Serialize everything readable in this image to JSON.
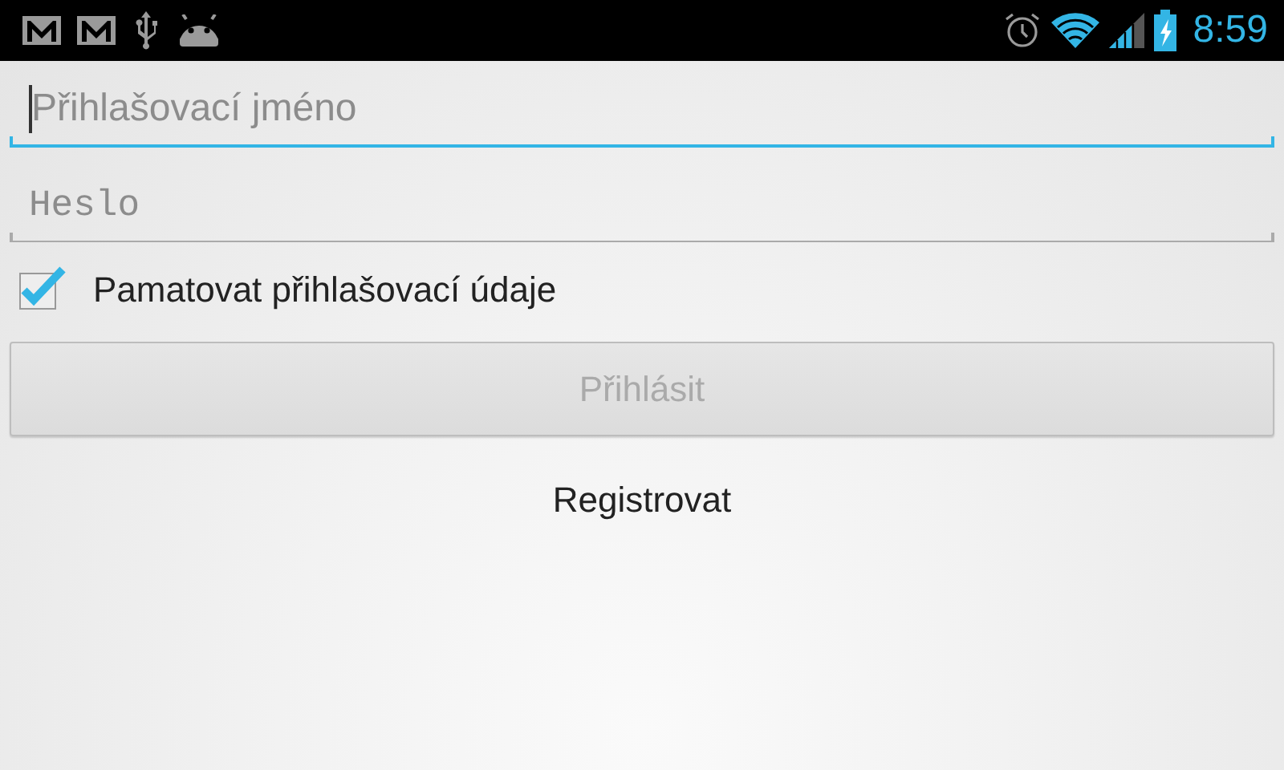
{
  "status_bar": {
    "time": "8:59"
  },
  "fields": [
    {
      "placeholder": "Přihlašovací jméno",
      "kind": "text",
      "focused": true
    },
    {
      "placeholder": "Heslo",
      "kind": "password",
      "focused": false
    }
  ],
  "remember": {
    "label": "Pamatovat přihlašovací údaje",
    "checked": true
  },
  "buttons": [
    {
      "label": "Přihlásit",
      "kind": "raised",
      "disabled": true
    },
    {
      "label": "Registrovat",
      "kind": "flat",
      "disabled": false
    }
  ]
}
